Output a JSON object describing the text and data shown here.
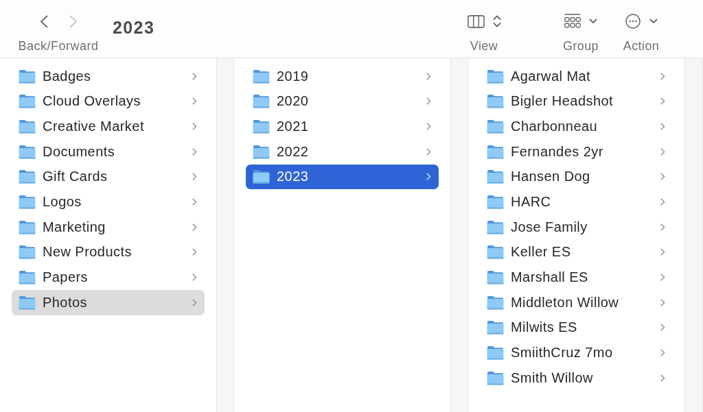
{
  "toolbar": {
    "back_disabled": false,
    "forward_disabled": true,
    "nav_label": "Back/Forward",
    "title": "2023",
    "tools": [
      {
        "kind": "columns",
        "label": "View"
      },
      {
        "kind": "group",
        "label": "Group"
      },
      {
        "kind": "action",
        "label": "Action"
      }
    ]
  },
  "columns": [
    {
      "items": [
        {
          "name": "Badges",
          "selected": false
        },
        {
          "name": "Cloud Overlays",
          "selected": false
        },
        {
          "name": "Creative Market",
          "selected": false
        },
        {
          "name": "Documents",
          "selected": false
        },
        {
          "name": "Gift Cards",
          "selected": false
        },
        {
          "name": "Logos",
          "selected": false
        },
        {
          "name": "Marketing",
          "selected": false
        },
        {
          "name": "New Products",
          "selected": false
        },
        {
          "name": "Papers",
          "selected": false
        },
        {
          "name": "Photos",
          "selected": true
        }
      ]
    },
    {
      "items": [
        {
          "name": "2019",
          "selected": false
        },
        {
          "name": "2020",
          "selected": false
        },
        {
          "name": "2021",
          "selected": false
        },
        {
          "name": "2022",
          "selected": false
        },
        {
          "name": "2023",
          "selected": true
        }
      ]
    },
    {
      "items": [
        {
          "name": "Agarwal Mat",
          "selected": false
        },
        {
          "name": "Bigler Headshot",
          "selected": false
        },
        {
          "name": "Charbonneau",
          "selected": false
        },
        {
          "name": "Fernandes 2yr",
          "selected": false
        },
        {
          "name": "Hansen Dog",
          "selected": false
        },
        {
          "name": "HARC",
          "selected": false
        },
        {
          "name": "Jose Family",
          "selected": false
        },
        {
          "name": "Keller ES",
          "selected": false
        },
        {
          "name": "Marshall ES",
          "selected": false
        },
        {
          "name": "Middleton Willow",
          "selected": false
        },
        {
          "name": "Milwits ES",
          "selected": false
        },
        {
          "name": "SmiithCruz 7mo",
          "selected": false
        },
        {
          "name": "Smith Willow",
          "selected": false
        }
      ]
    }
  ]
}
